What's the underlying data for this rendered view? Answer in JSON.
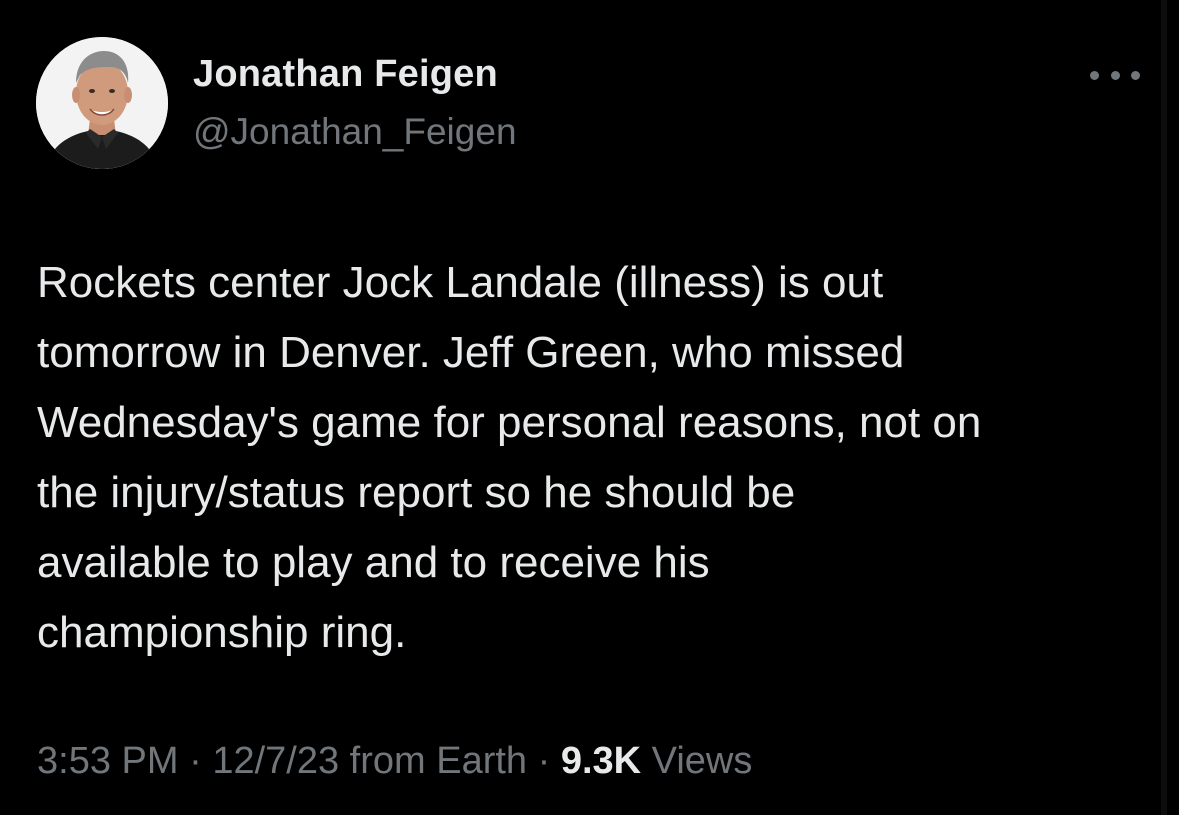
{
  "author": {
    "name": "Jonathan Feigen",
    "handle": "@Jonathan_Feigen"
  },
  "more_icon": "more-horizontal-icon",
  "tweet": {
    "lines": [
      "Rockets center Jock Landale (illness) is out",
      "tomorrow in Denver. Jeff Green, who missed",
      "Wednesday's game for personal reasons, not on",
      "the injury/status report so he should be",
      "available to play and to receive his",
      "championship ring."
    ]
  },
  "meta": {
    "time": "3:53 PM",
    "separator": " · ",
    "date": "12/7/23",
    "source": " from Earth",
    "views_count": "9.3K",
    "views_label": " Views"
  },
  "colors": {
    "background": "#000000",
    "primary_text": "#e7e9ea",
    "secondary_text": "#71767b"
  }
}
